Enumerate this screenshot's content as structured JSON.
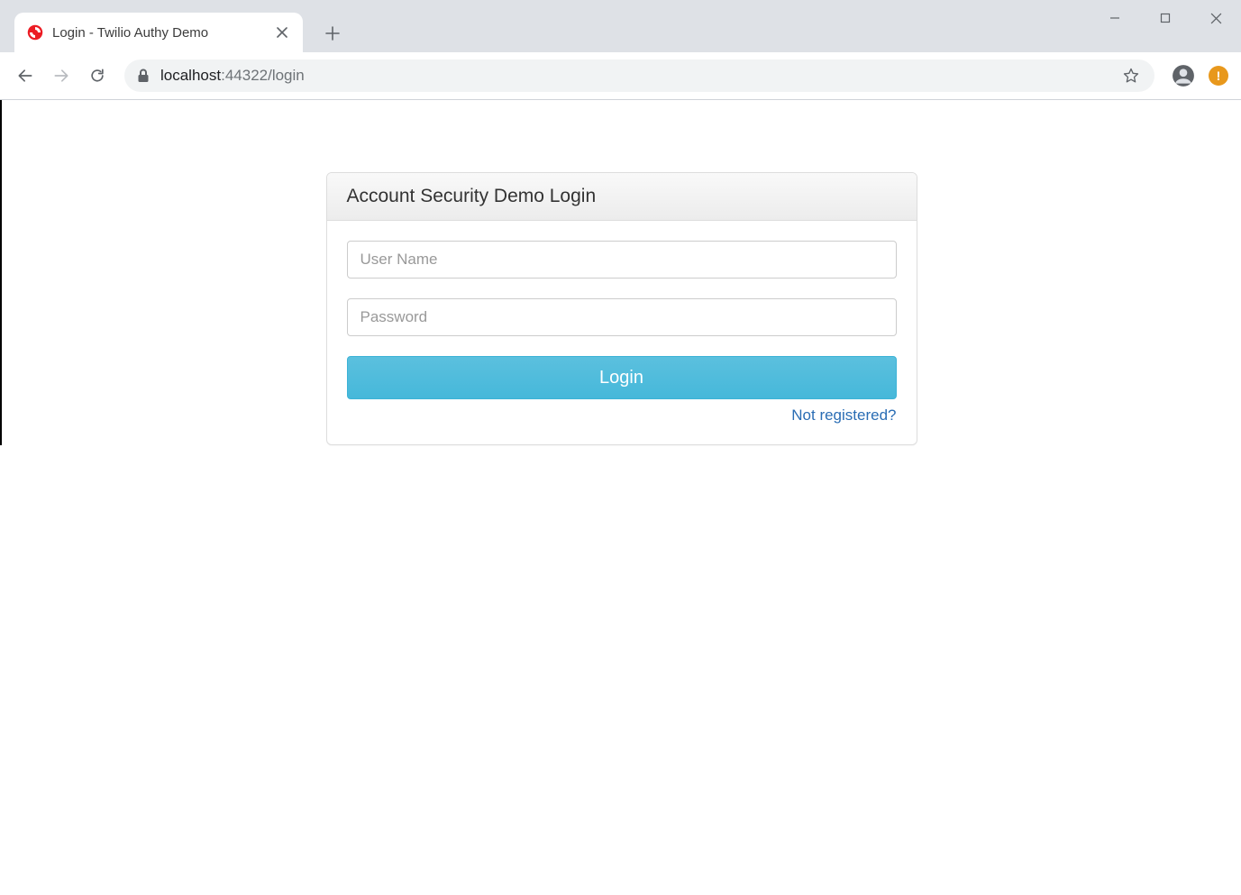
{
  "browser": {
    "tab_title": "Login - Twilio Authy Demo",
    "url_host": "localhost",
    "url_rest": ":44322/login"
  },
  "panel": {
    "title": "Account Security Demo Login",
    "username_placeholder": "User Name",
    "password_placeholder": "Password",
    "login_label": "Login",
    "register_label": "Not registered?"
  }
}
